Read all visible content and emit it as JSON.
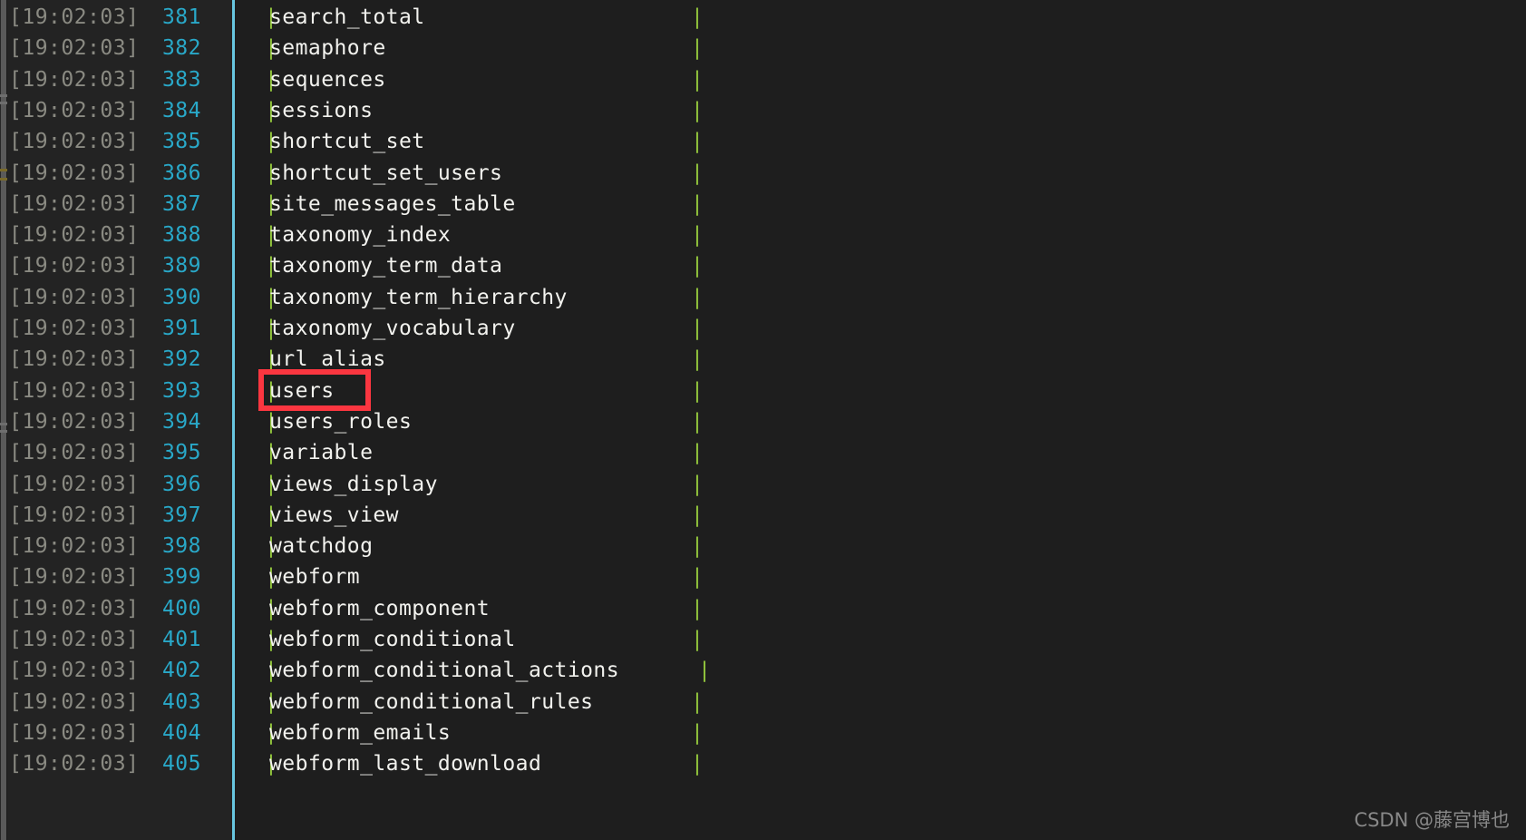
{
  "terminal": {
    "background_color": "#1e1e1e",
    "gutter_color": "#232323",
    "divider_color": "#68c6e0",
    "timestamp_color": "#8a8a82",
    "lineno_color": "#29a8c8",
    "pipe_color": "#94c83d",
    "text_color": "#f2f2ee",
    "highlight_color": "#fb3640",
    "pipe_left": "|",
    "pipe_right": "|",
    "rows": [
      {
        "timestamp": "[19:02:03]",
        "lineno": "381",
        "name": "search_total"
      },
      {
        "timestamp": "[19:02:03]",
        "lineno": "382",
        "name": "semaphore"
      },
      {
        "timestamp": "[19:02:03]",
        "lineno": "383",
        "name": "sequences"
      },
      {
        "timestamp": "[19:02:03]",
        "lineno": "384",
        "name": "sessions"
      },
      {
        "timestamp": "[19:02:03]",
        "lineno": "385",
        "name": "shortcut_set"
      },
      {
        "timestamp": "[19:02:03]",
        "lineno": "386",
        "name": "shortcut_set_users"
      },
      {
        "timestamp": "[19:02:03]",
        "lineno": "387",
        "name": "site_messages_table"
      },
      {
        "timestamp": "[19:02:03]",
        "lineno": "388",
        "name": "taxonomy_index"
      },
      {
        "timestamp": "[19:02:03]",
        "lineno": "389",
        "name": "taxonomy_term_data"
      },
      {
        "timestamp": "[19:02:03]",
        "lineno": "390",
        "name": "taxonomy_term_hierarchy"
      },
      {
        "timestamp": "[19:02:03]",
        "lineno": "391",
        "name": "taxonomy_vocabulary"
      },
      {
        "timestamp": "[19:02:03]",
        "lineno": "392",
        "name": "url_alias"
      },
      {
        "timestamp": "[19:02:03]",
        "lineno": "393",
        "name": "users"
      },
      {
        "timestamp": "[19:02:03]",
        "lineno": "394",
        "name": "users_roles"
      },
      {
        "timestamp": "[19:02:03]",
        "lineno": "395",
        "name": "variable"
      },
      {
        "timestamp": "[19:02:03]",
        "lineno": "396",
        "name": "views_display"
      },
      {
        "timestamp": "[19:02:03]",
        "lineno": "397",
        "name": "views_view"
      },
      {
        "timestamp": "[19:02:03]",
        "lineno": "398",
        "name": "watchdog"
      },
      {
        "timestamp": "[19:02:03]",
        "lineno": "399",
        "name": "webform"
      },
      {
        "timestamp": "[19:02:03]",
        "lineno": "400",
        "name": "webform_component"
      },
      {
        "timestamp": "[19:02:03]",
        "lineno": "401",
        "name": "webform_conditional"
      },
      {
        "timestamp": "[19:02:03]",
        "lineno": "402",
        "name": "webform_conditional_actions"
      },
      {
        "timestamp": "[19:02:03]",
        "lineno": "403",
        "name": "webform_conditional_rules"
      },
      {
        "timestamp": "[19:02:03]",
        "lineno": "404",
        "name": "webform_emails"
      },
      {
        "timestamp": "[19:02:03]",
        "lineno": "405",
        "name": "webform_last_download"
      }
    ],
    "highlighted_row_index": 12
  },
  "watermark": {
    "text": "CSDN @藤宫博也"
  }
}
